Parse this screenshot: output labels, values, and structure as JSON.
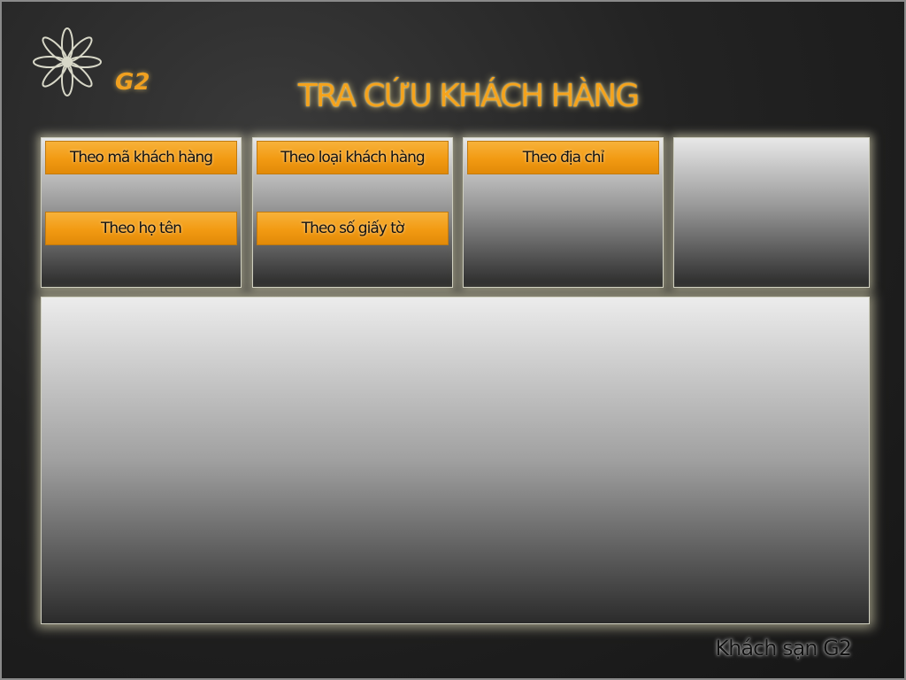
{
  "logo": {
    "text": "G2",
    "icon": "flower-icon"
  },
  "title": "TRA CỨU KHÁCH HÀNG",
  "search_buttons": [
    {
      "label": "Theo mã khách hàng"
    },
    {
      "label": "Theo loại khách hàng"
    },
    {
      "label": "Theo địa chỉ"
    },
    {
      "label": "Theo họ tên"
    },
    {
      "label": "Theo số giấy tờ"
    }
  ],
  "footer": "Khách sạn G2",
  "colors": {
    "accent": "#f29a12",
    "title": "#f5a31c",
    "background": "#232323",
    "panel_glow": "#fffad2"
  }
}
